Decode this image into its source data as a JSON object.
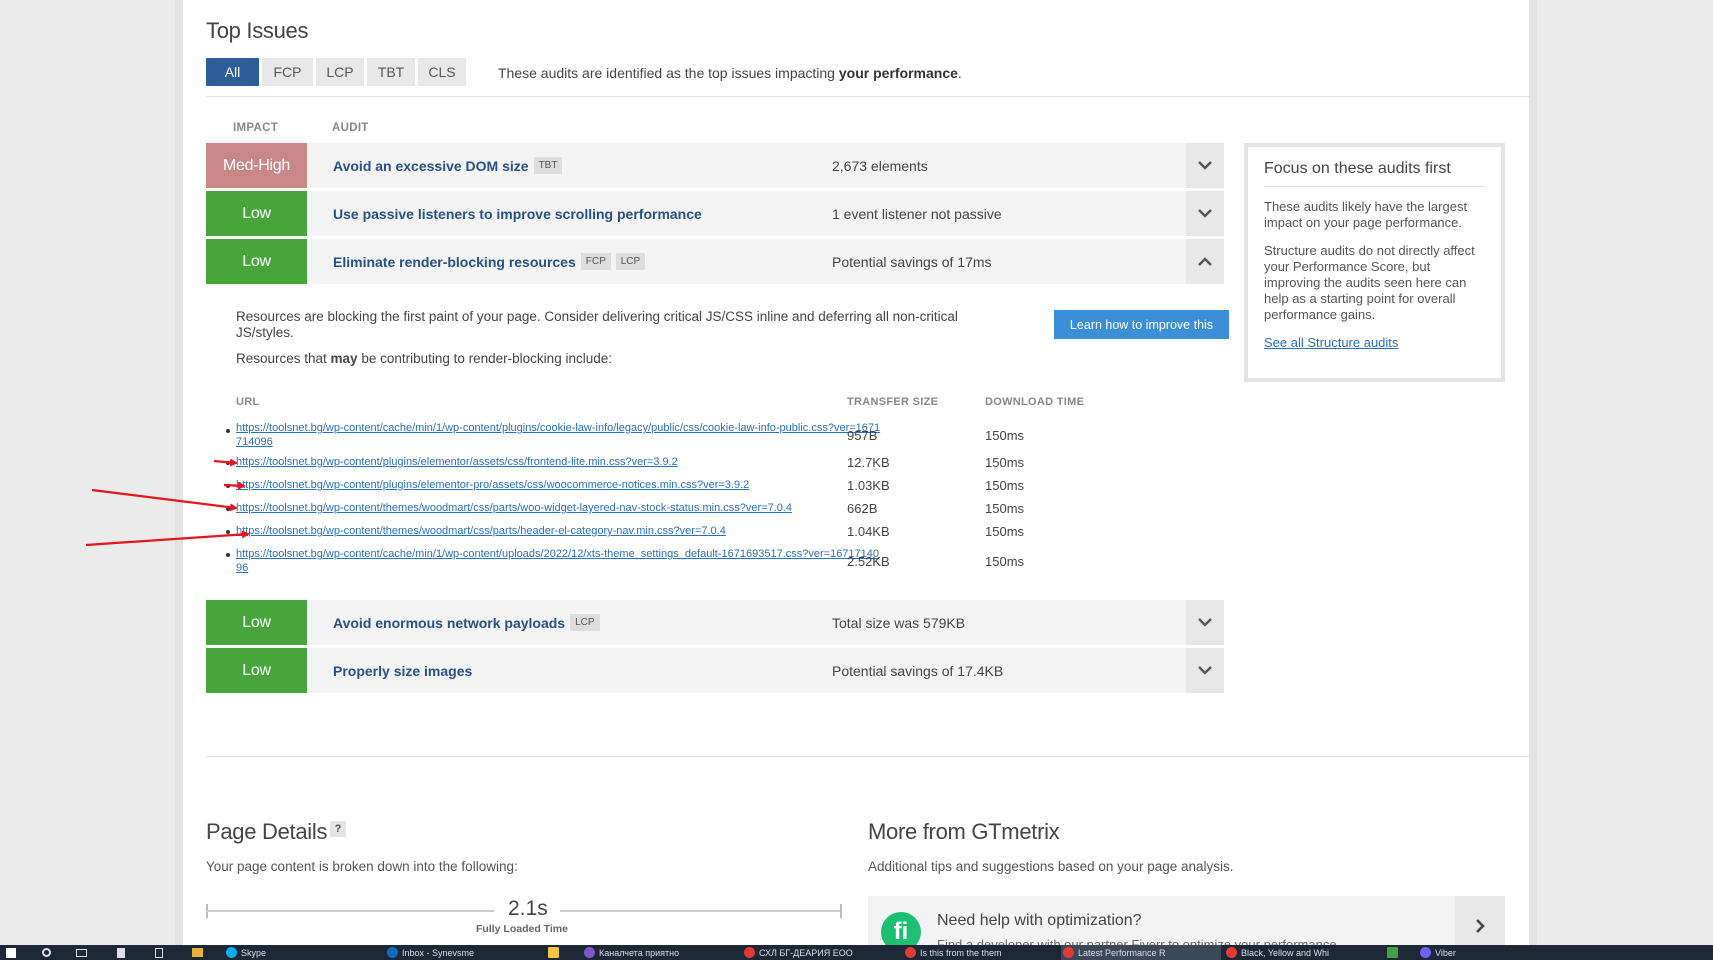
{
  "top_issues": {
    "title": "Top Issues",
    "tabs": [
      "All",
      "FCP",
      "LCP",
      "TBT",
      "CLS"
    ],
    "active_tab": "All",
    "description_prefix": "These audits are identified as the top issues impacting ",
    "description_bold": "your performance",
    "description_suffix": "."
  },
  "columns": {
    "impact": "IMPACT",
    "audit": "AUDIT"
  },
  "audits": [
    {
      "impact": "Med-High",
      "title": "Avoid an excessive DOM size",
      "tags": [
        "TBT"
      ],
      "meta": "2,673 elements",
      "expanded": false
    },
    {
      "impact": "Low",
      "title": "Use passive listeners to improve scrolling performance",
      "tags": [],
      "meta": "1 event listener not passive",
      "expanded": false
    },
    {
      "impact": "Low",
      "title": "Eliminate render-blocking resources",
      "tags": [
        "FCP",
        "LCP"
      ],
      "meta": "Potential savings of 17ms",
      "expanded": true
    },
    {
      "impact": "Low",
      "title": "Avoid enormous network payloads",
      "tags": [
        "LCP"
      ],
      "meta": "Total size was 579KB",
      "expanded": false
    },
    {
      "impact": "Low",
      "title": "Properly size images",
      "tags": [],
      "meta": "Potential savings of 17.4KB",
      "expanded": false
    }
  ],
  "expanded_detail": {
    "description": "Resources are blocking the first paint of your page. Consider delivering critical JS/CSS inline and deferring all non-critical JS/styles.",
    "list_intro_prefix": "Resources that ",
    "list_intro_bold": "may",
    "list_intro_suffix": " be contributing to render-blocking include:",
    "learn_button": "Learn how to improve this",
    "headers": {
      "url": "URL",
      "transfer_size": "TRANSFER SIZE",
      "download_time": "DOWNLOAD TIME"
    },
    "resources": [
      {
        "url": "https://toolsnet.bg/wp-content/cache/min/1/wp-content/plugins/cookie-law-info/legacy/public/css/cookie-law-info-public.css?ver=1671714096",
        "size": "957B",
        "time": "150ms"
      },
      {
        "url": "https://toolsnet.bg/wp-content/plugins/elementor/assets/css/frontend-lite.min.css?ver=3.9.2",
        "size": "12.7KB",
        "time": "150ms"
      },
      {
        "url": "https://toolsnet.bg/wp-content/plugins/elementor-pro/assets/css/woocommerce-notices.min.css?ver=3.9.2",
        "size": "1.03KB",
        "time": "150ms"
      },
      {
        "url": "https://toolsnet.bg/wp-content/themes/woodmart/css/parts/woo-widget-layered-nav-stock-status.min.css?ver=7.0.4",
        "size": "662B",
        "time": "150ms"
      },
      {
        "url": "https://toolsnet.bg/wp-content/themes/woodmart/css/parts/header-el-category-nav.min.css?ver=7.0.4",
        "size": "1.04KB",
        "time": "150ms"
      },
      {
        "url": "https://toolsnet.bg/wp-content/cache/min/1/wp-content/uploads/2022/12/xts-theme_settings_default-1671693517.css?ver=1671714096",
        "size": "2.52KB",
        "time": "150ms"
      }
    ]
  },
  "focus_box": {
    "title": "Focus on these audits first",
    "p1": "These audits likely have the largest impact on your page performance.",
    "p2": "Structure audits do not directly affect your Performance Score, but improving the audits seen here can help as a starting point for overall performance gains.",
    "link": "See all Structure audits"
  },
  "page_details": {
    "title": "Page Details",
    "help": "?",
    "subtitle": "Your page content is broken down into the following:",
    "fully_loaded_value": "2.1s",
    "fully_loaded_label": "Fully Loaded Time"
  },
  "more_from": {
    "title": "More from GTmetrix",
    "subtitle": "Additional tips and suggestions based on your page analysis.",
    "card_title": "Need help with optimization?",
    "card_sub": "Find a developer with our partner Fiverr to optimize your performance"
  },
  "taskbar": {
    "items": [
      {
        "label": "Skype",
        "color": "#00aff0"
      },
      {
        "label": "Inbox - Synevsme",
        "color": "#0f6cbd"
      },
      {
        "label": "",
        "color": "#f5c542"
      },
      {
        "label": "Каналчета приятно",
        "color": "#7e57c2"
      },
      {
        "label": "СХЛ БГ-ДЕАРИЯ ЕОО",
        "color": "#e53935"
      },
      {
        "label": "Is this from the them",
        "color": "#e53935"
      },
      {
        "label": "Latest Performance R",
        "color": "#e53935"
      },
      {
        "label": "Black, Yellow and Whi",
        "color": "#e53935"
      },
      {
        "label": "",
        "color": "#43a047"
      },
      {
        "label": "Viber",
        "color": "#7360f2"
      }
    ]
  },
  "colors": {
    "active_tab": "#2d5e9c",
    "impact_low": "#47a53c",
    "impact_medhigh": "#c98787",
    "link": "#2a6fbd",
    "audit_title": "#275183",
    "learn_button": "#3a8fd6",
    "annotation_arrows": "#e8141b"
  }
}
